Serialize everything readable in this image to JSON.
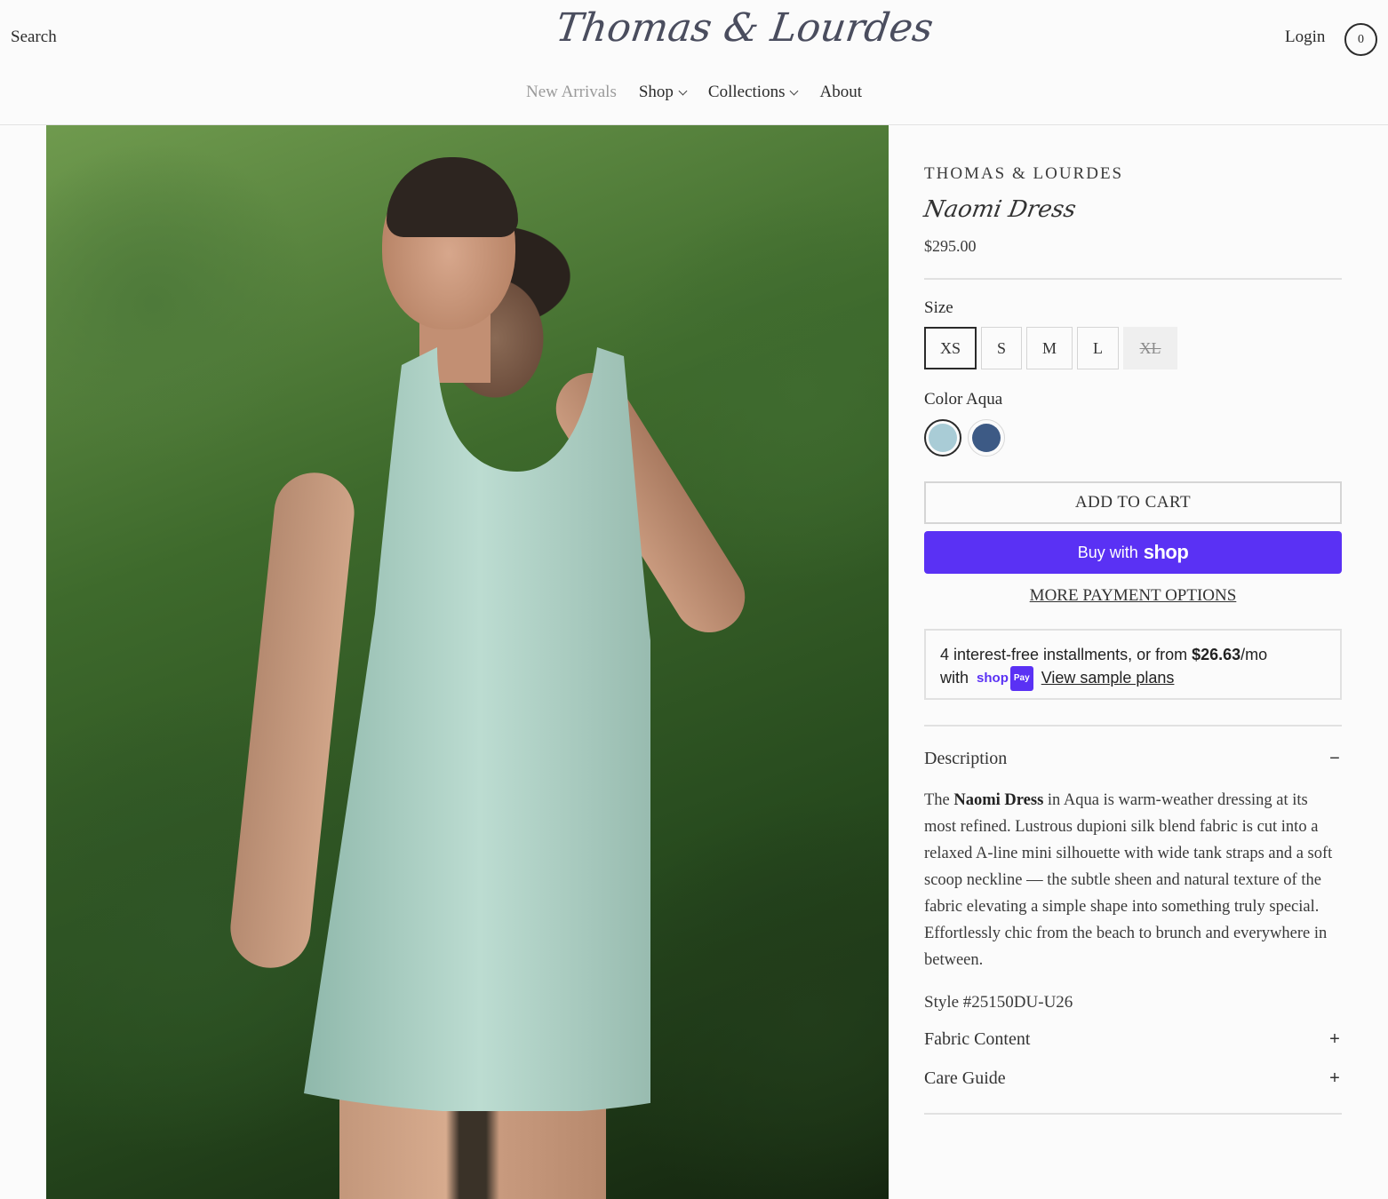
{
  "header": {
    "search_label": "Search",
    "logo_text": "Thomas & Lourdes",
    "login_label": "Login",
    "cart_count": "0"
  },
  "nav": {
    "items": [
      {
        "label": "New Arrivals",
        "has_dropdown": false
      },
      {
        "label": "Shop",
        "has_dropdown": true
      },
      {
        "label": "Collections",
        "has_dropdown": true
      },
      {
        "label": "About",
        "has_dropdown": false
      }
    ]
  },
  "product": {
    "brand": "THOMAS & LOURDES",
    "title": "Naomi Dress",
    "price": "$295.00",
    "size_label": "Size",
    "sizes": [
      {
        "label": "XS",
        "state": "selected"
      },
      {
        "label": "S",
        "state": "available"
      },
      {
        "label": "M",
        "state": "available"
      },
      {
        "label": "L",
        "state": "available"
      },
      {
        "label": "XL",
        "state": "sold-out"
      }
    ],
    "color_label": "Color",
    "color_value": "Aqua",
    "colors": [
      {
        "name": "Aqua",
        "hex": "#a9ccd6",
        "selected": true
      },
      {
        "name": "Navy",
        "hex": "#3d5a85",
        "selected": false
      }
    ],
    "add_to_cart": "ADD TO CART",
    "buy_with": "Buy with",
    "shop_word": "shop",
    "more_payment": "MORE PAYMENT OPTIONS",
    "installments": {
      "line1_prefix": "4 interest-free installments, or from ",
      "amount": "$26.63",
      "line1_suffix": "/mo",
      "line2_prefix": "with",
      "badge_shop": "shop",
      "badge_pay": "Pay",
      "link": "View sample plans"
    },
    "description_heading": "Description",
    "description_intro": "The ",
    "description_bold": "Naomi Dress",
    "description_rest": " in Aqua is warm-weather dressing at its most refined. Lustrous dupioni silk blend fabric is cut into a relaxed A-line mini silhouette with wide tank straps and a soft scoop neckline — the subtle sheen and natural texture of the fabric elevating a simple shape into something truly special. Effortlessly chic from the beach to brunch and everywhere in between.",
    "style_number": "Style #25150DU-U26",
    "fabric_heading": "Fabric Content",
    "care_heading": "Care Guide",
    "expanded_sign": "−",
    "collapsed_sign": "+"
  },
  "colors": {
    "accent_shop_pay": "#5a31f4",
    "dress": "#a9cfc3"
  }
}
